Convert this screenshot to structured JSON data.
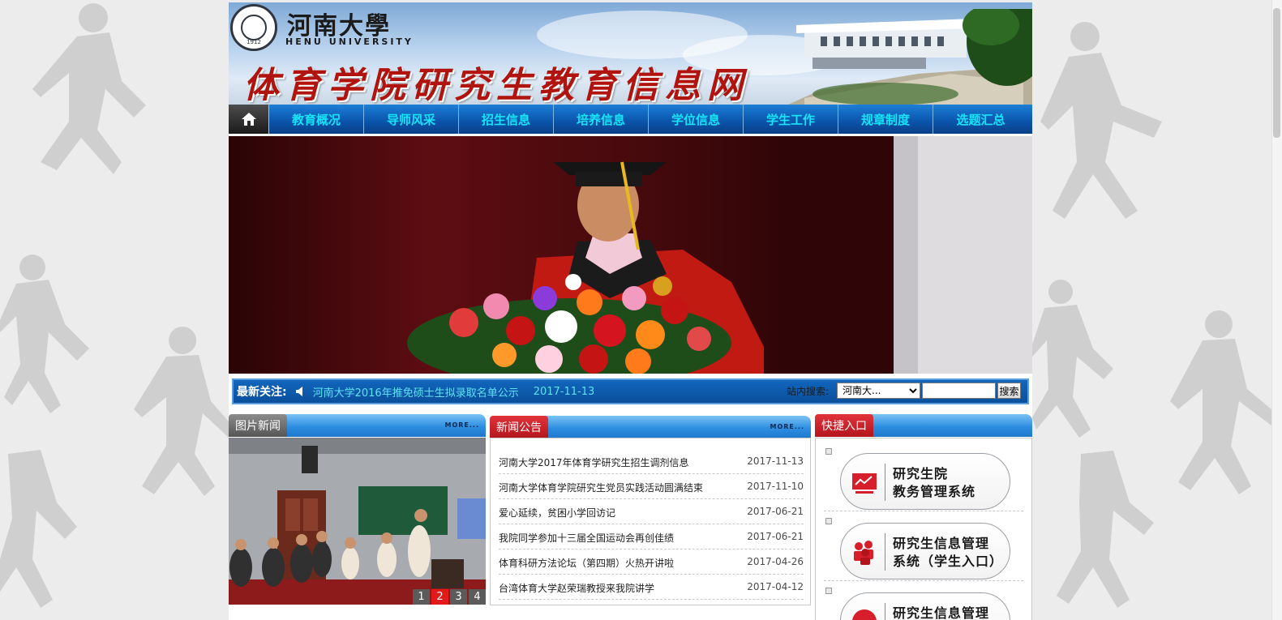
{
  "header": {
    "university_cn": "河南大學",
    "university_en": "HENU UNIVERSITY",
    "seal_year": "1912",
    "site_title": "体育学院研究生教育信息网"
  },
  "nav": {
    "home_icon": "home-icon",
    "items": [
      {
        "label": "教育概况"
      },
      {
        "label": "导师风采"
      },
      {
        "label": "招生信息"
      },
      {
        "label": "培养信息"
      },
      {
        "label": "学位信息"
      },
      {
        "label": "学生工作"
      },
      {
        "label": "规章制度"
      },
      {
        "label": "选题汇总"
      }
    ]
  },
  "notice": {
    "label": "最新关注:",
    "headline": "河南大学2016年推免硕士生拟录取名单公示",
    "date": "2017-11-13",
    "search_label": "站内搜索:",
    "search_scope": "河南大...",
    "search_button": "搜索"
  },
  "photo_news": {
    "title": "图片新闻",
    "more": "MORE...",
    "pages": [
      "1",
      "2",
      "3",
      "4"
    ],
    "active_page": "2"
  },
  "news": {
    "title": "新闻公告",
    "more": "MORE...",
    "items": [
      {
        "title": "河南大学2017年体育学研究生招生调剂信息",
        "date": "2017-11-13"
      },
      {
        "title": "河南大学体育学院研究生党员实践活动圆满结束",
        "date": "2017-11-10"
      },
      {
        "title": "爱心延续，贫困小学回访记",
        "date": "2017-06-21"
      },
      {
        "title": "我院同学参加十三届全国运动会再创佳绩",
        "date": "2017-06-21"
      },
      {
        "title": "体育科研方法论坛（第四期）火热开讲啦",
        "date": "2017-04-26"
      },
      {
        "title": "台湾体育大学赵荣瑞教授来我院讲学",
        "date": "2017-04-12"
      }
    ]
  },
  "quick": {
    "title": "快捷入口",
    "items": [
      {
        "line1": "研究生院",
        "line2": "教务管理系统",
        "icon": "chart-board-icon"
      },
      {
        "line1": "研究生信息管理",
        "line2": "系统（学生入口）",
        "icon": "users-icon"
      },
      {
        "line1": "研究生信息管理",
        "line2": "",
        "icon": "circle-icon"
      }
    ]
  },
  "colors": {
    "nav_text": "#17e4f7",
    "title_red": "#b1140f",
    "active_page": "#e21a1a",
    "notice_text": "#5fe1f3"
  }
}
